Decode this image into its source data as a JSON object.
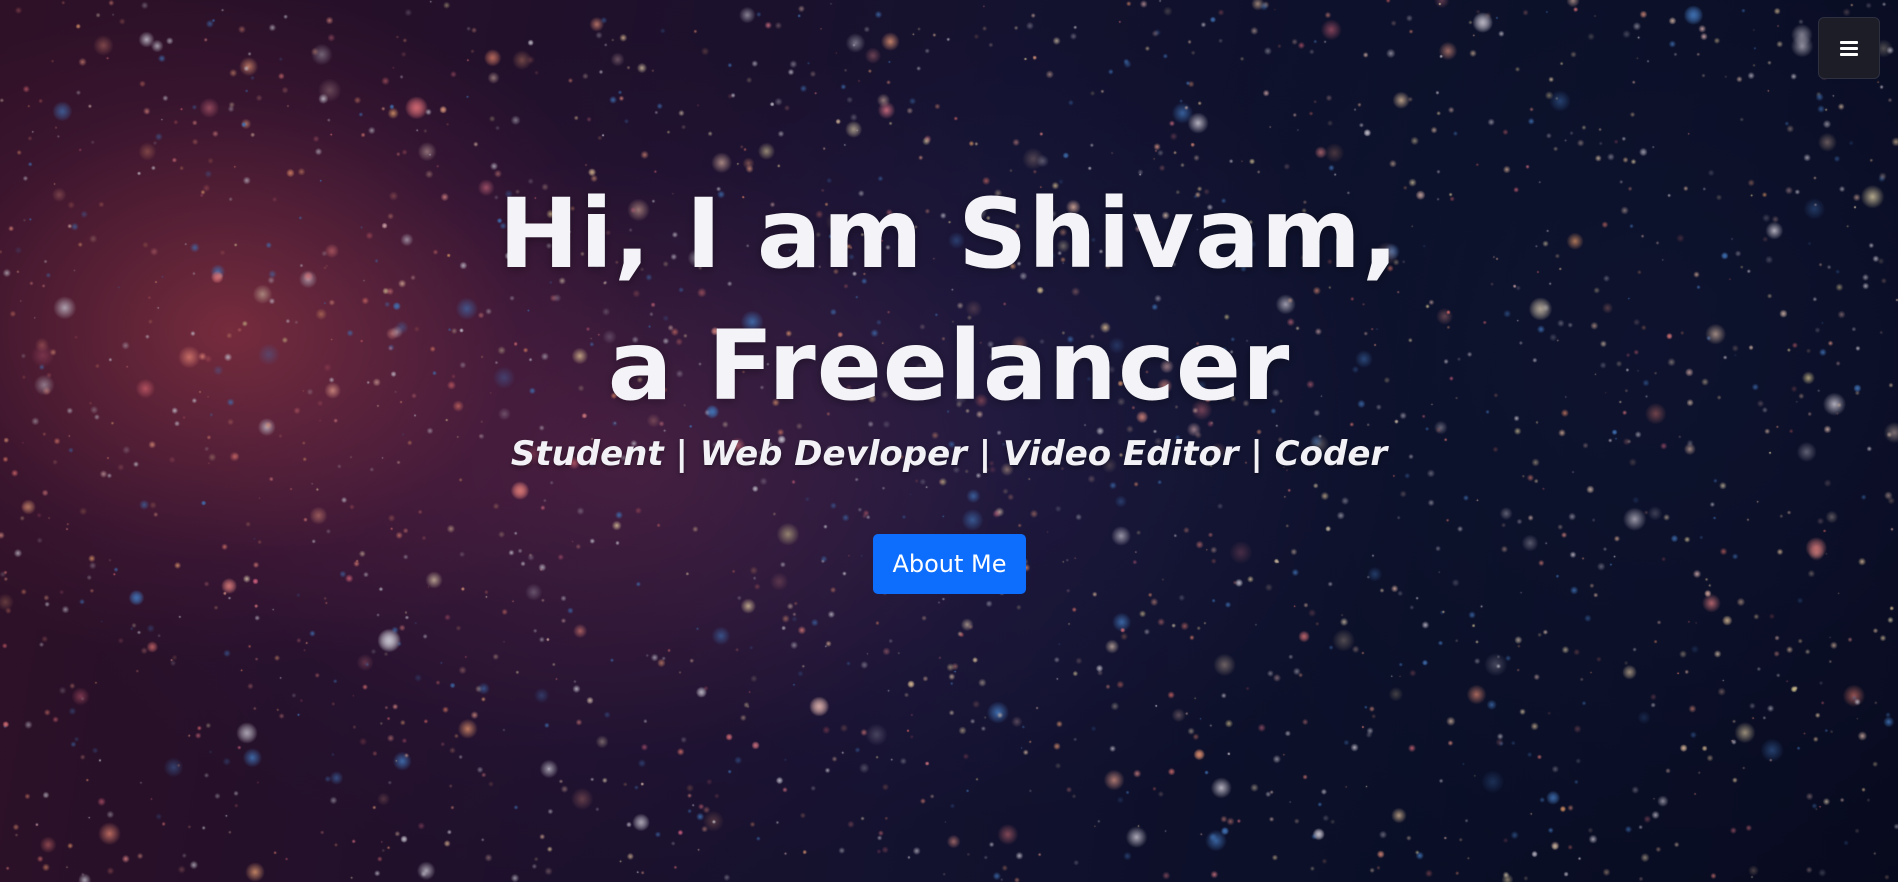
{
  "hero": {
    "headline_line1": "Hi, I am Shivam,",
    "headline_line2": "a Freelancer",
    "subtitle": "Student | Web Devloper | Video Editor | Coder",
    "about_button_label": "About Me"
  },
  "nav": {
    "menu_icon": "hamburger-menu-icon"
  },
  "colors": {
    "button_primary": "#0d6efd",
    "menu_button_bg": "#1c1d26",
    "text": "#ffffff"
  }
}
